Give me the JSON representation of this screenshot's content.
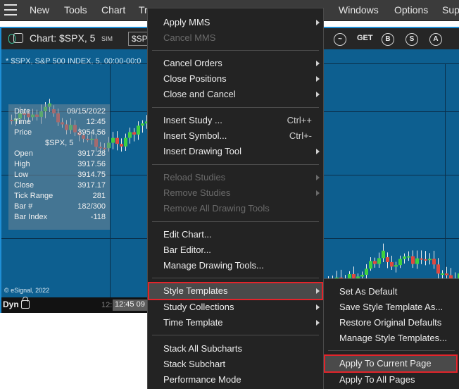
{
  "menubar": {
    "items": [
      "New",
      "Tools",
      "Chart",
      "Tr",
      "Windows",
      "Options",
      "Sup"
    ]
  },
  "chart": {
    "title": "Chart: $SPX, 5",
    "sim": "SIM",
    "symbol_box": "$SP",
    "get_label": "GET",
    "tool_icons": [
      "B",
      "S",
      "A"
    ],
    "subtitle": "* $SPX, S&P 500 INDEX, 5, 00:00-00:0",
    "copyright": "© eSignal, 2022",
    "status": {
      "dyn": "Dyn",
      "time_dim": "12:",
      "time": "12:45 09"
    },
    "data_panel": {
      "symbol": "$SPX, 5",
      "rows": [
        {
          "label": "Date",
          "value": "09/15/2022"
        },
        {
          "label": "Time",
          "value": "12:45"
        },
        {
          "label": "Price",
          "value": "3954.56"
        },
        {
          "label": "Open",
          "value": "3917.28"
        },
        {
          "label": "High",
          "value": "3917.56"
        },
        {
          "label": "Low",
          "value": "3914.75"
        },
        {
          "label": "Close",
          "value": "3917.17"
        },
        {
          "label": "Tick Range",
          "value": "281"
        },
        {
          "label": "Bar #",
          "value": "182/300"
        },
        {
          "label": "Bar Index",
          "value": "-118"
        }
      ]
    },
    "colors": {
      "up": "#3fd13f",
      "down": "#e0483f",
      "wick": "#f0f0f0",
      "bg": "#0d5f90"
    }
  },
  "main_menu": {
    "items": [
      {
        "label": "Apply MMS",
        "submenu": true
      },
      {
        "label": "Cancel MMS",
        "disabled": true
      },
      {
        "label": "Cancel Orders",
        "submenu": true
      },
      {
        "label": "Close Positions",
        "submenu": true
      },
      {
        "label": "Close and Cancel",
        "submenu": true
      },
      {
        "label": "Insert Study ...",
        "shortcut": "Ctrl++"
      },
      {
        "label": "Insert Symbol...",
        "shortcut": "Ctrl+-"
      },
      {
        "label": "Insert Drawing Tool",
        "submenu": true
      },
      {
        "label": "Reload Studies",
        "submenu": true,
        "disabled": true
      },
      {
        "label": "Remove Studies",
        "submenu": true,
        "disabled": true
      },
      {
        "label": "Remove All Drawing Tools",
        "disabled": true
      },
      {
        "label": "Edit Chart..."
      },
      {
        "label": "Bar Editor..."
      },
      {
        "label": "Manage Drawing Tools..."
      },
      {
        "label": "Style Templates",
        "submenu": true,
        "highlight": true
      },
      {
        "label": "Study Collections",
        "submenu": true
      },
      {
        "label": "Time Template",
        "submenu": true
      },
      {
        "label": "Stack All Subcharts"
      },
      {
        "label": "Stack Subchart"
      },
      {
        "label": "Performance Mode"
      }
    ]
  },
  "sub_menu": {
    "items": [
      {
        "label": "Set As Default"
      },
      {
        "label": "Save Style Template As..."
      },
      {
        "label": "Restore Original Defaults"
      },
      {
        "label": "Manage Style Templates..."
      },
      {
        "label": "Apply To Current Page",
        "highlight": true
      },
      {
        "label": "Apply To All Pages"
      }
    ]
  }
}
